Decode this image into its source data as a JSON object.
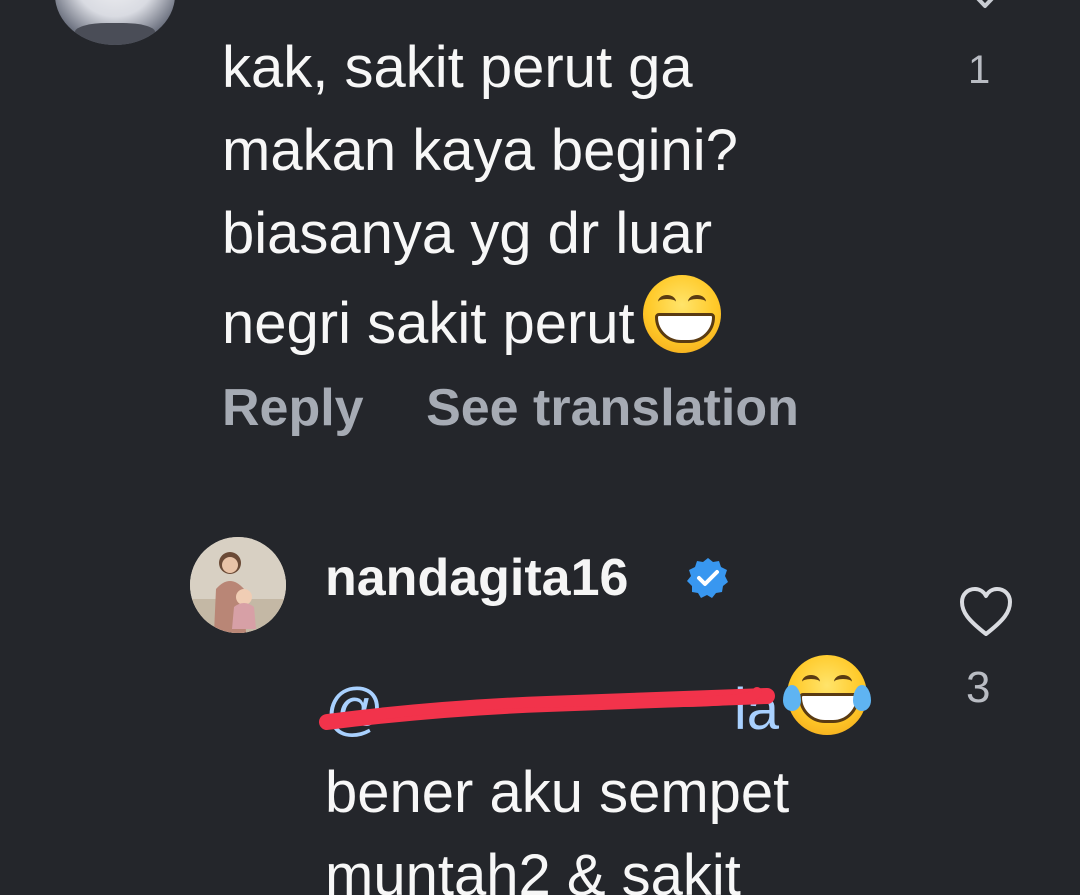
{
  "comment_top": {
    "lines": [
      "kak, sakit perut ga",
      "makan kaya begini?",
      "biasanya yg dr luar",
      "negri sakit perut"
    ],
    "emoji": "grinning-face-with-smiling-eyes-icon",
    "likes": "1"
  },
  "actions": {
    "reply": "Reply",
    "see_translation": "See translation"
  },
  "reply_comment": {
    "username": "nandagita16",
    "mention": "@",
    "mention_visible_tail": "ia",
    "lines": [
      "bener aku sempet",
      "muntah2 & sakit"
    ],
    "emoji": "face-with-tears-of-joy-icon",
    "likes": "3"
  },
  "colors": {
    "background": "#24262b",
    "text": "#f7f7f7",
    "muted": "#a6abb4",
    "mention": "#a9d1ff",
    "verified": "#3897f0",
    "redaction": "#f2334b"
  }
}
